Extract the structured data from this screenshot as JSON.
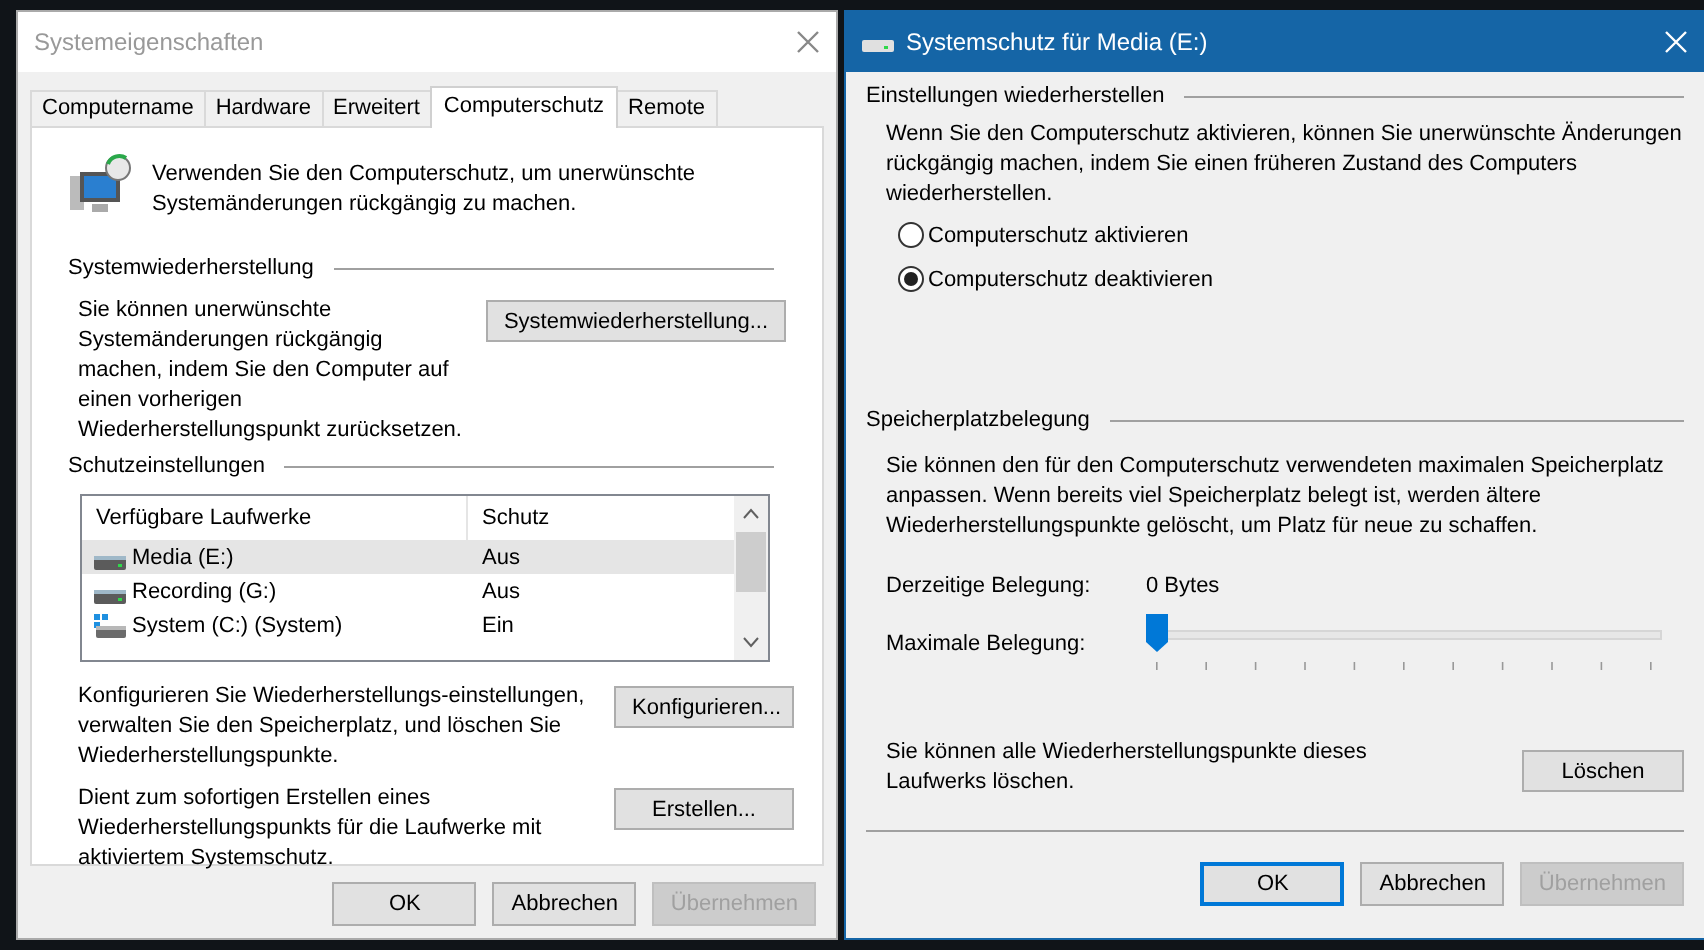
{
  "left_window": {
    "title": "Systemeigenschaften",
    "tabs": [
      {
        "label": "Computername",
        "selected": false
      },
      {
        "label": "Hardware",
        "selected": false
      },
      {
        "label": "Erweitert",
        "selected": false
      },
      {
        "label": "Computerschutz",
        "selected": true
      },
      {
        "label": "Remote",
        "selected": false
      }
    ],
    "intro": "Verwenden Sie den Computerschutz, um unerwünschte Systemänderungen rückgängig zu machen.",
    "restore_section": {
      "heading": "Systemwiederherstellung",
      "text": "Sie können unerwünschte Systemänderungen rückgängig machen, indem Sie den Computer auf einen vorherigen Wiederherstellungspunkt zurücksetzen.",
      "button": "Systemwiederherstellung..."
    },
    "protection_section": {
      "heading": "Schutzeinstellungen",
      "table": {
        "columns": [
          "Verfügbare Laufwerke",
          "Schutz"
        ],
        "rows": [
          {
            "kind": "drive",
            "name": "Media (E:)",
            "protection": "Aus",
            "selected": true
          },
          {
            "kind": "drive",
            "name": "Recording (G:)",
            "protection": "Aus",
            "selected": false
          },
          {
            "kind": "system",
            "name": "System (C:) (System)",
            "protection": "Ein",
            "selected": false
          }
        ]
      },
      "actions": [
        {
          "text": "Konfigurieren Sie Wiederherstellungs-einstellungen, verwalten Sie den Speicherplatz, und löschen Sie Wiederherstellungspunkte.",
          "button": "Konfigurieren..."
        },
        {
          "text": "Dient zum sofortigen Erstellen eines Wiederherstellungspunkts für die Laufwerke mit aktiviertem Systemschutz.",
          "button": "Erstellen..."
        }
      ]
    },
    "buttons": [
      {
        "label": "OK",
        "disabled": false,
        "default": false
      },
      {
        "label": "Abbrechen",
        "disabled": false,
        "default": false
      },
      {
        "label": "Übernehmen",
        "disabled": true,
        "default": false
      }
    ]
  },
  "right_window": {
    "title": "Systemschutz für Media (E:)",
    "restore_settings": {
      "heading": "Einstellungen wiederherstellen",
      "text": "Wenn Sie den Computerschutz aktivieren, können Sie unerwünschte Änderungen rückgängig machen, indem Sie einen früheren Zustand des Computers wiederherstellen.",
      "options": [
        {
          "label": "Computerschutz aktivieren",
          "selected": false
        },
        {
          "label": "Computerschutz deaktivieren",
          "selected": true
        }
      ]
    },
    "disk_usage": {
      "heading": "Speicherplatzbelegung",
      "text": "Sie können den für den Computerschutz verwendeten maximalen Speicherplatz anpassen. Wenn bereits viel Speicherplatz belegt ist, werden ältere Wiederherstellungspunkte gelöscht, um Platz für neue zu schaffen.",
      "current_label": "Derzeitige Belegung:",
      "current_value": "0 Bytes",
      "max_label": "Maximale Belegung:",
      "max_slider": {
        "level": 0
      }
    },
    "delete": {
      "text": "Sie können alle Wiederherstellungspunkte dieses Laufwerks löschen.",
      "button": "Löschen"
    },
    "buttons": [
      {
        "label": "OK",
        "disabled": false,
        "default": true
      },
      {
        "label": "Abbrechen",
        "disabled": false,
        "default": false
      },
      {
        "label": "Übernehmen",
        "disabled": true,
        "default": false
      }
    ]
  }
}
